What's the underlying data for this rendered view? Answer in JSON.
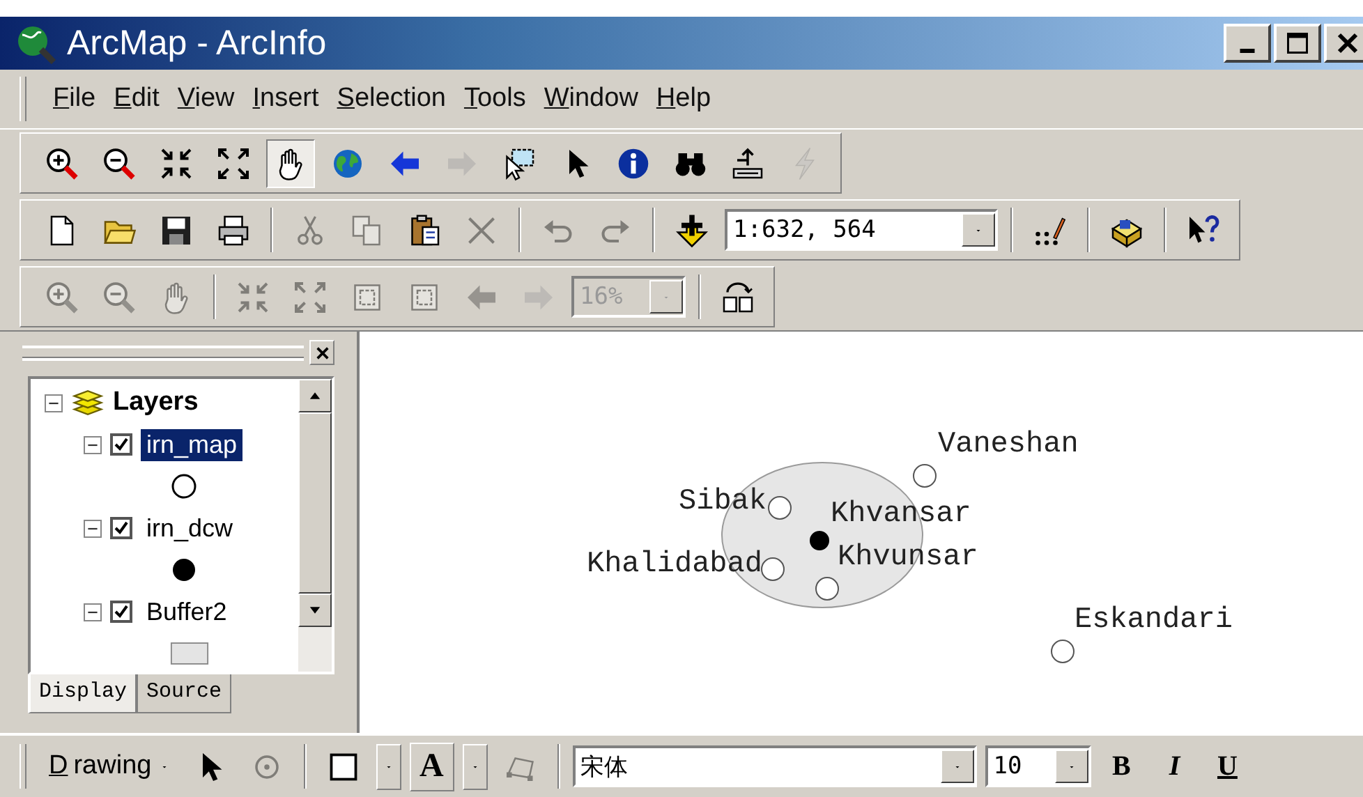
{
  "window": {
    "title": "ArcMap - ArcInfo"
  },
  "menu": [
    {
      "label": "File"
    },
    {
      "label": "Edit"
    },
    {
      "label": "View"
    },
    {
      "label": "Insert"
    },
    {
      "label": "Selection"
    },
    {
      "label": "Tools"
    },
    {
      "label": "Window"
    },
    {
      "label": "Help"
    }
  ],
  "toolbars": [
    {
      "items": [
        {
          "kind": "button",
          "disabled": false,
          "pressed": false
        },
        {
          "kind": "button",
          "disabled": false,
          "pressed": false
        },
        {
          "kind": "button",
          "disabled": false,
          "pressed": false
        },
        {
          "kind": "button",
          "disabled": false,
          "pressed": false
        },
        {
          "kind": "button",
          "disabled": false,
          "pressed": true
        },
        {
          "kind": "button",
          "disabled": false,
          "pressed": false
        },
        {
          "kind": "button",
          "disabled": false,
          "pressed": false
        },
        {
          "kind": "button",
          "disabled": true,
          "pressed": false
        },
        {
          "kind": "button",
          "disabled": false,
          "pressed": false
        },
        {
          "kind": "button",
          "disabled": false,
          "pressed": false
        },
        {
          "kind": "button",
          "disabled": false,
          "pressed": false
        },
        {
          "kind": "button",
          "disabled": false,
          "pressed": false
        },
        {
          "kind": "button",
          "disabled": false,
          "pressed": false
        },
        {
          "kind": "button",
          "disabled": true,
          "pressed": false
        }
      ]
    },
    {
      "items": [
        {
          "kind": "button",
          "disabled": false,
          "pressed": false
        },
        {
          "kind": "button",
          "disabled": false,
          "pressed": false
        },
        {
          "kind": "button",
          "disabled": false,
          "pressed": false
        },
        {
          "kind": "button",
          "disabled": false,
          "pressed": false
        },
        {
          "kind": "separator"
        },
        {
          "kind": "button",
          "disabled": true,
          "pressed": false
        },
        {
          "kind": "button",
          "disabled": true,
          "pressed": false
        },
        {
          "kind": "button",
          "disabled": false,
          "pressed": false
        },
        {
          "kind": "button",
          "disabled": true,
          "pressed": false
        },
        {
          "kind": "separator"
        },
        {
          "kind": "button",
          "disabled": true,
          "pressed": false
        },
        {
          "kind": "button",
          "disabled": true,
          "pressed": false
        },
        {
          "kind": "separator"
        },
        {
          "kind": "button",
          "disabled": false,
          "pressed": false
        },
        {
          "kind": "combo",
          "value": "1:632, 564",
          "disabled": false
        },
        {
          "kind": "separator"
        },
        {
          "kind": "button",
          "disabled": false,
          "pressed": false
        },
        {
          "kind": "separator"
        },
        {
          "kind": "button",
          "disabled": false,
          "pressed": false
        },
        {
          "kind": "separator"
        },
        {
          "kind": "button",
          "disabled": false,
          "pressed": false
        }
      ]
    },
    {
      "items": [
        {
          "kind": "button",
          "disabled": true,
          "pressed": false
        },
        {
          "kind": "button",
          "disabled": true,
          "pressed": false
        },
        {
          "kind": "button",
          "disabled": true,
          "pressed": false
        },
        {
          "kind": "separator"
        },
        {
          "kind": "button",
          "disabled": true,
          "pressed": false
        },
        {
          "kind": "button",
          "disabled": true,
          "pressed": false
        },
        {
          "kind": "button",
          "disabled": true,
          "pressed": false
        },
        {
          "kind": "button",
          "disabled": true,
          "pressed": false
        },
        {
          "kind": "button",
          "disabled": true,
          "pressed": false
        },
        {
          "kind": "button",
          "disabled": true,
          "pressed": false
        },
        {
          "kind": "combo",
          "value": "16%",
          "disabled": true
        },
        {
          "kind": "separator"
        },
        {
          "kind": "button",
          "disabled": false,
          "pressed": false
        }
      ]
    }
  ],
  "toc": {
    "root": {
      "label": "Layers",
      "expanded": true,
      "children": [
        {
          "label": "irn_map",
          "checked": true,
          "expanded": true,
          "selected": true,
          "legend": {
            "kind": "hollow-circle"
          }
        },
        {
          "label": "irn_dcw",
          "checked": true,
          "expanded": true,
          "selected": false,
          "legend": {
            "kind": "filled-circle"
          }
        },
        {
          "label": "Buffer2",
          "checked": true,
          "expanded": true,
          "selected": false,
          "legend": {
            "kind": "polygon"
          }
        }
      ]
    },
    "tabs": [
      {
        "label": "Display",
        "selected": true
      },
      {
        "label": "Source",
        "selected": false
      }
    ]
  },
  "map": {
    "features": [
      {
        "kind": "buffer"
      },
      {
        "kind": "point",
        "label": "Vaneshan",
        "filled": false
      },
      {
        "kind": "point",
        "label": "Sibak",
        "filled": false
      },
      {
        "kind": "point",
        "label": "Khvansar",
        "filled": true
      },
      {
        "kind": "point",
        "label": "Khalidabad",
        "filled": false
      },
      {
        "kind": "point",
        "label": "Khvunsar",
        "filled": false
      },
      {
        "kind": "point",
        "label": "Eskandari",
        "filled": false
      }
    ]
  },
  "drawing_toolbar": [
    {
      "kind": "menu",
      "label": "Drawing"
    },
    {
      "kind": "button",
      "disabled": false
    },
    {
      "kind": "button",
      "disabled": true
    },
    {
      "kind": "separator"
    },
    {
      "kind": "split-button",
      "disabled": false
    },
    {
      "kind": "split-button",
      "label": "A",
      "disabled": false
    },
    {
      "kind": "button",
      "disabled": true
    },
    {
      "kind": "separator"
    },
    {
      "kind": "combo",
      "value": "宋体"
    },
    {
      "kind": "combo",
      "value": "10"
    },
    {
      "kind": "bold",
      "label": "B"
    },
    {
      "kind": "italic",
      "label": "I"
    },
    {
      "kind": "underline",
      "label": "U"
    }
  ]
}
